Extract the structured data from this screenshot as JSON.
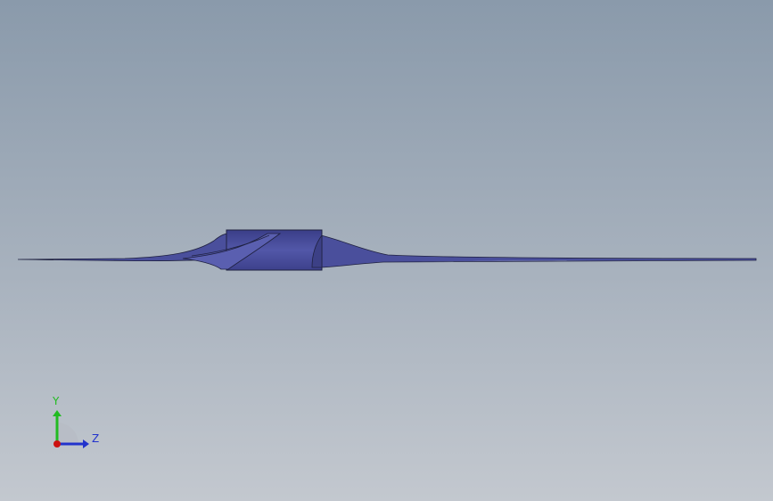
{
  "viewport": {
    "background_top": "#8a9aab",
    "background_bottom": "#c3c8cf"
  },
  "model": {
    "name": "propeller-blade-side-view",
    "color": "#4a4f9c",
    "shade_color": "#3c4086",
    "edge_color": "#1f2140"
  },
  "triad": {
    "y_label": "Y",
    "z_label": "Z",
    "y_color": "#22bb22",
    "z_color": "#2233cc",
    "x_color": "#cc1111"
  }
}
